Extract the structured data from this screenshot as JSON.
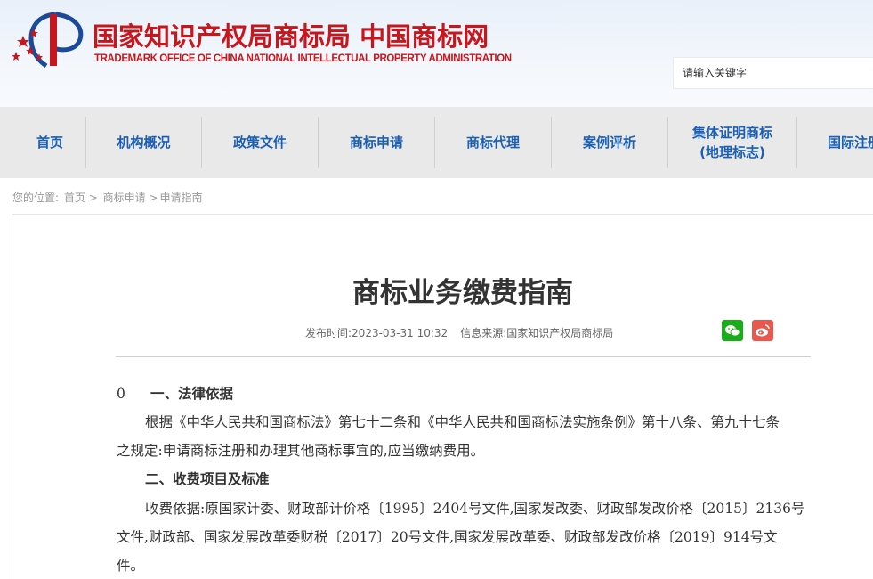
{
  "header": {
    "title_cn": "国家知识产权局商标局 中国商标网",
    "title_en": "TRADEMARK OFFICE OF CHINA NATIONAL INTELLECTUAL PROPERTY ADMINISTRATION",
    "search_placeholder": "请输入关键字",
    "brand_color": "#c8161d"
  },
  "nav": {
    "items": [
      {
        "label": "首页"
      },
      {
        "label": "机构概况"
      },
      {
        "label": "政策文件"
      },
      {
        "label": "商标申请"
      },
      {
        "label": "商标代理"
      },
      {
        "label": "案例评析"
      },
      {
        "label": "集体证明商标\n(地理标志)"
      },
      {
        "label": "国际注册"
      }
    ],
    "link_color": "#1a5fb4"
  },
  "breadcrumb": {
    "prefix": "您的位置:",
    "items": [
      "首页 >",
      "商标申请 >",
      "申请指南"
    ]
  },
  "article": {
    "title": "商标业务缴费指南",
    "publish": "发布时间:2023-03-31 10:32",
    "source": "信息来源:国家知识产权局商标局",
    "share": [
      {
        "icon": "wechat-icon",
        "color": "#1aad19"
      },
      {
        "icon": "weibo-icon",
        "color": "#e8584f"
      }
    ],
    "paragraphs": [
      {
        "marker": "0",
        "text": "一、法律依据"
      },
      {
        "text": "根据《中华人民共和国商标法》第七十二条和《中华人民共和国商标法实施条例》第十八条、第九十七条"
      },
      {
        "text": "之规定:申请商标注册和办理其他商标事宜的,应当缴纳费用。"
      },
      {
        "text": "二、收费项目及标准"
      },
      {
        "text": "收费依据:原国家计委、财政部计价格〔1995〕2404号文件,国家发改委、财政部发改价格〔2015〕2136号"
      },
      {
        "text": "文件,财政部、国家发展改革委财税〔2017〕20号文件,国家发展改革委、财政部发改价格〔2019〕914号文"
      },
      {
        "text": "件。"
      }
    ]
  }
}
